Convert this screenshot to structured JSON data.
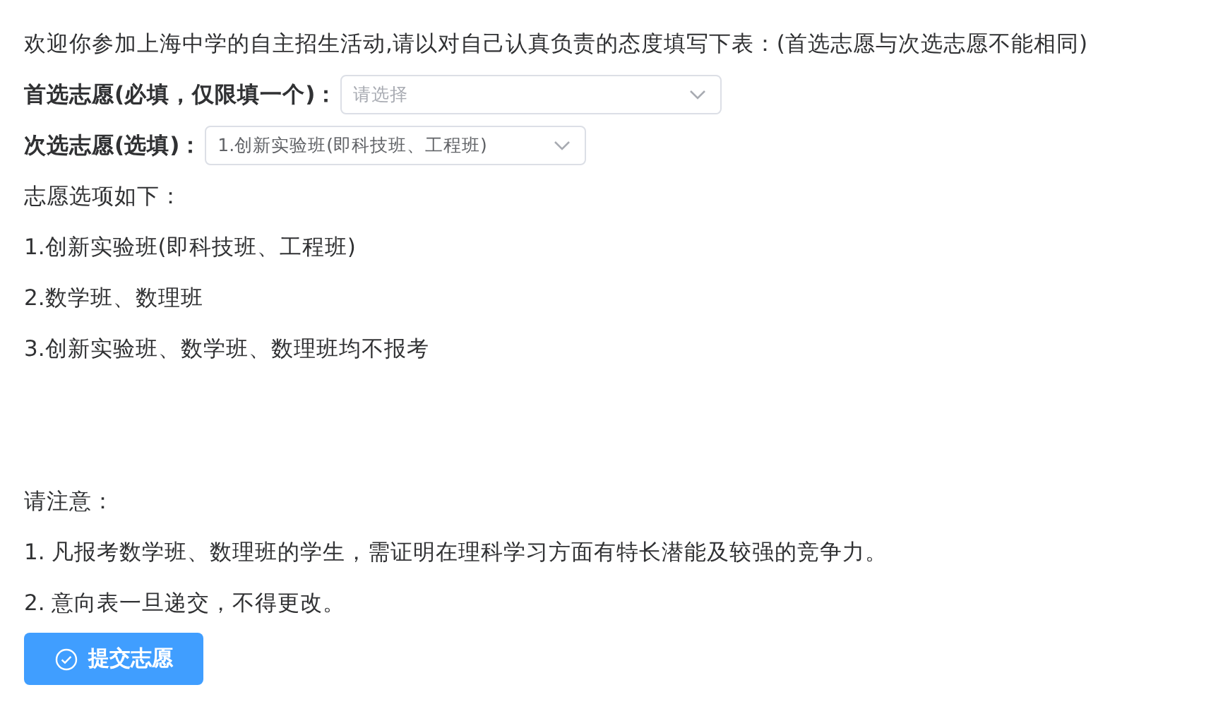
{
  "intro": "欢迎你参加上海中学的自主招生活动,请以对自己认真负责的态度填写下表：(首选志愿与次选志愿不能相同)",
  "fields": [
    {
      "label": "首选志愿(必填，仅限填一个)：",
      "placeholder": "请选择"
    },
    {
      "label": "次选志愿(选填)：",
      "value": "1.创新实验班(即科技班、工程班)"
    }
  ],
  "options_title": "志愿选项如下：",
  "options": [
    "1.创新实验班(即科技班、工程班)",
    "2.数学班、数理班",
    "3.创新实验班、数学班、数理班均不报考"
  ],
  "notice_title": "请注意：",
  "notices": [
    "1. 凡报考数学班、数理班的学生，需证明在理科学习方面有特长潜能及较强的竞争力。",
    "2. 意向表一旦递交，不得更改。"
  ],
  "submit_button": "提交志愿"
}
